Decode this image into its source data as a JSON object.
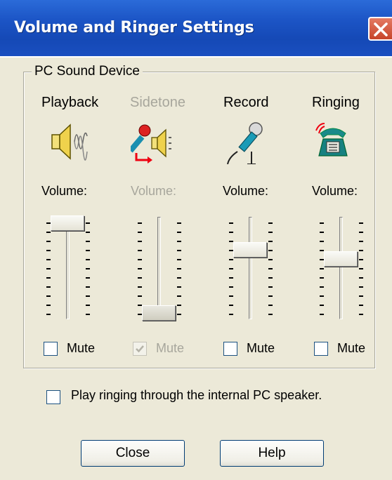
{
  "window": {
    "title": "Volume and Ringer Settings",
    "close_icon": "close-icon"
  },
  "group": {
    "legend": "PC Sound Device"
  },
  "columns": [
    {
      "label": "Playback",
      "icon": "speaker-icon",
      "volume_label": "Volume:",
      "volume_level": 1.0,
      "enabled": true,
      "mute_label": "Mute",
      "muted": false
    },
    {
      "label": "Sidetone",
      "icon": "microphone-to-speaker-icon",
      "volume_label": "Volume:",
      "volume_level": 0.0,
      "enabled": false,
      "mute_label": "Mute",
      "muted": true
    },
    {
      "label": "Record",
      "icon": "microphone-icon",
      "volume_label": "Volume:",
      "volume_level": 0.7,
      "enabled": true,
      "mute_label": "Mute",
      "muted": false
    },
    {
      "label": "Ringing",
      "icon": "telephone-icon",
      "volume_label": "Volume:",
      "volume_level": 0.6,
      "enabled": true,
      "mute_label": "Mute",
      "muted": false
    }
  ],
  "ring_internal": {
    "label": "Play ringing through the internal PC speaker.",
    "checked": false
  },
  "buttons": {
    "close": "Close",
    "help": "Help"
  },
  "colors": {
    "titlebar": "#1c55c6",
    "dialog_bg": "#ece9d8",
    "disabled_text": "#a7a69c",
    "button_border": "#003c74"
  }
}
